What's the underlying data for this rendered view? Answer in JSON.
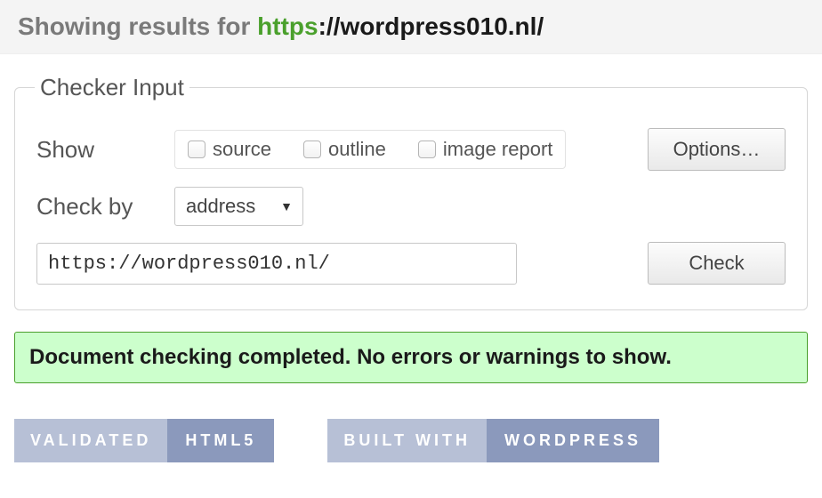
{
  "header": {
    "prefix": "Showing results for ",
    "scheme": "https",
    "rest": "://wordpress010.nl/"
  },
  "checker": {
    "legend": "Checker Input",
    "show_label": "Show",
    "checkboxes": {
      "source": "source",
      "outline": "outline",
      "image_report": "image report"
    },
    "options_btn": "Options…",
    "checkby_label": "Check by",
    "checkby_selected": "address",
    "url_value": "https://wordpress010.nl/",
    "check_btn": "Check"
  },
  "result": {
    "message": "Document checking completed. No errors or warnings to show."
  },
  "badges": {
    "validated_left": "VALIDATED",
    "validated_right": "HTML5",
    "built_left": "BUILT WITH",
    "built_right": "WORDPRESS"
  }
}
